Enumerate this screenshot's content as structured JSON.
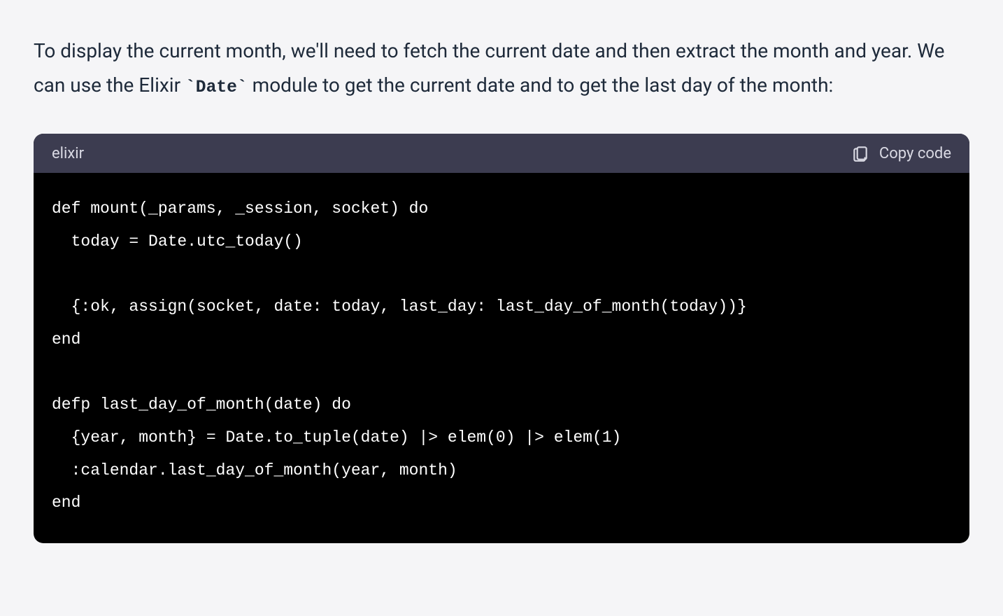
{
  "prose": {
    "text_before_code": "To display the current month, we'll need to fetch the current date and then extract the month and year. We can use the Elixir ",
    "inline_code": "`Date`",
    "text_after_code": " module to get the current date and to get the last day of the month:"
  },
  "code_block": {
    "language": "elixir",
    "copy_label": "Copy code",
    "code": "def mount(_params, _session, socket) do\n  today = Date.utc_today()\n\n  {:ok, assign(socket, date: today, last_day: last_day_of_month(today))}\nend\n\ndefp last_day_of_month(date) do\n  {year, month} = Date.to_tuple(date) |> elem(0) |> elem(1)\n  :calendar.last_day_of_month(year, month)\nend"
  }
}
